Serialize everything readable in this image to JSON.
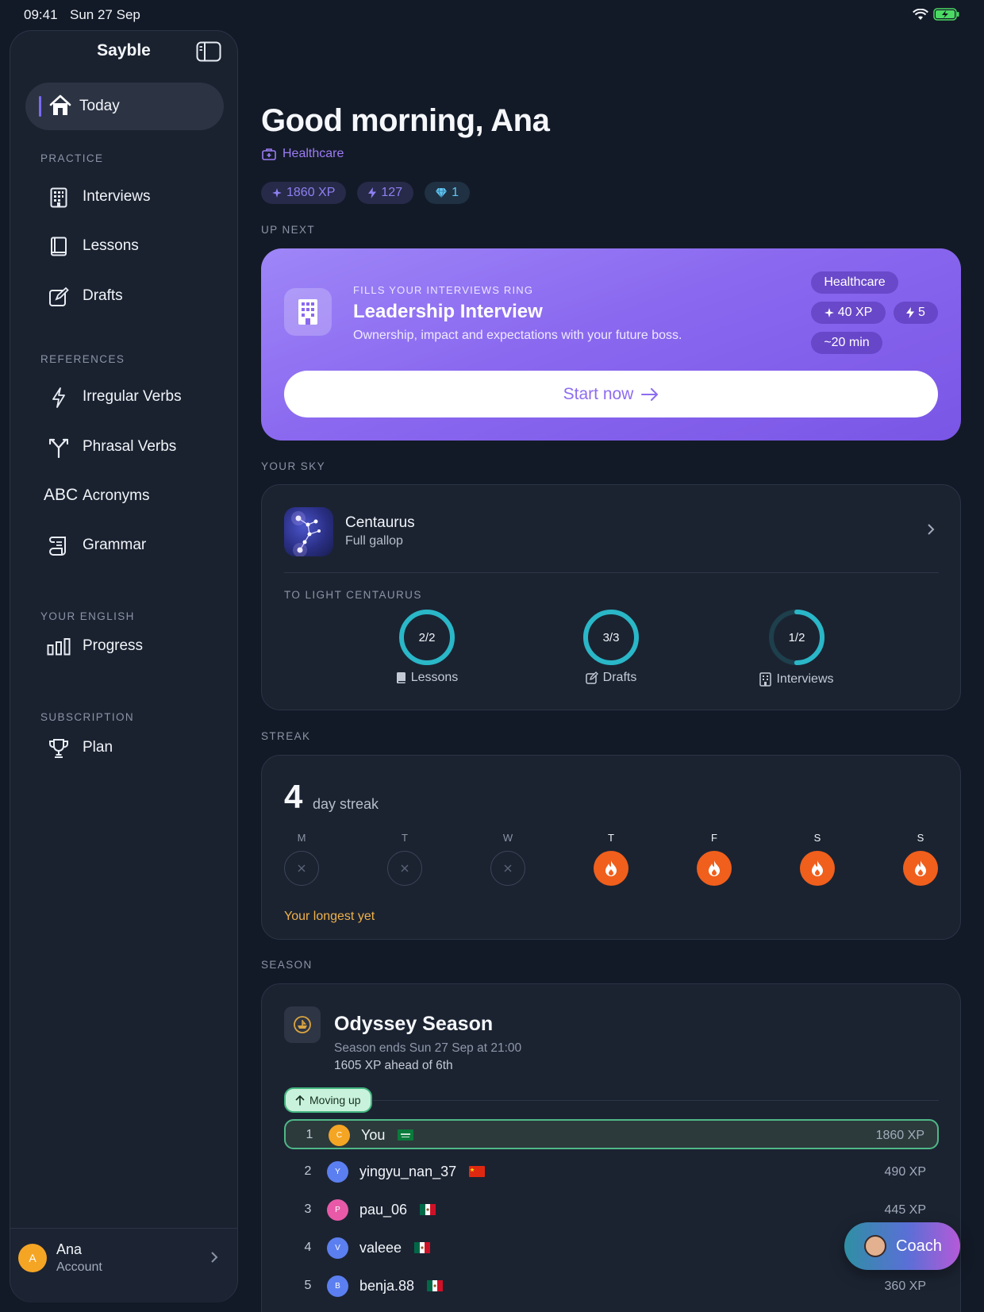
{
  "status_bar": {
    "time": "09:41",
    "date": "Sun 27 Sep"
  },
  "sidebar": {
    "app_title": "Sayble",
    "today": "Today",
    "sections": {
      "practice": "PRACTICE",
      "references": "REFERENCES",
      "your_english": "YOUR ENGLISH",
      "subscription": "SUBSCRIPTION"
    },
    "items": {
      "interviews": "Interviews",
      "lessons": "Lessons",
      "drafts": "Drafts",
      "irregular_verbs": "Irregular Verbs",
      "phrasal_verbs": "Phrasal Verbs",
      "acronyms_glyph": "ABC",
      "acronyms": "Acronyms",
      "grammar": "Grammar",
      "progress": "Progress",
      "plan": "Plan"
    },
    "account": {
      "avatar_letter": "A",
      "name": "Ana",
      "sub": "Account"
    }
  },
  "header": {
    "greeting": "Good morning, Ana",
    "track": "Healthcare",
    "stats": {
      "xp": "1860 XP",
      "streak": "127",
      "gems": "1"
    }
  },
  "up_next": {
    "label": "UP NEXT",
    "kicker": "FILLS YOUR INTERVIEWS RING",
    "title": "Leadership Interview",
    "description": "Ownership, impact and expectations with your future boss.",
    "tag": "Healthcare",
    "xp": "40 XP",
    "energy": "5",
    "duration": "~20 min",
    "cta": "Start now"
  },
  "sky": {
    "label": "YOUR SKY",
    "constellation": "Centaurus",
    "subtitle": "Full gallop",
    "rings_label": "TO LIGHT CENTAURUS",
    "rings": [
      {
        "value": "2/2",
        "label": "Lessons",
        "progress": 1.0
      },
      {
        "value": "3/3",
        "label": "Drafts",
        "progress": 1.0
      },
      {
        "value": "1/2",
        "label": "Interviews",
        "progress": 0.5
      }
    ]
  },
  "streak": {
    "label": "STREAK",
    "count": "4",
    "text": "day streak",
    "days": [
      {
        "letter": "M",
        "done": false
      },
      {
        "letter": "T",
        "done": false
      },
      {
        "letter": "W",
        "done": false
      },
      {
        "letter": "T",
        "done": true
      },
      {
        "letter": "F",
        "done": true
      },
      {
        "letter": "S",
        "done": true
      },
      {
        "letter": "S",
        "done": true
      }
    ],
    "note": "Your longest yet"
  },
  "season": {
    "label": "SEASON",
    "title": "Odyssey Season",
    "ends": "Season ends Sun 27 Sep at 21:00",
    "ahead": "1605 XP ahead of 6th",
    "moving_up": "Moving up",
    "leaderboard": [
      {
        "rank": "1",
        "initial": "C",
        "name": "You",
        "xp": "1860 XP",
        "color": "#f5a524",
        "flag": "sa"
      },
      {
        "rank": "2",
        "initial": "Y",
        "name": "yingyu_nan_37",
        "xp": "490 XP",
        "color": "#5b7ff0",
        "flag": "cn"
      },
      {
        "rank": "3",
        "initial": "P",
        "name": "pau_06",
        "xp": "445 XP",
        "color": "#e85aa8",
        "flag": "mx"
      },
      {
        "rank": "4",
        "initial": "V",
        "name": "valeee",
        "xp": "",
        "color": "#5b7ff0",
        "flag": "mx"
      },
      {
        "rank": "5",
        "initial": "B",
        "name": "benja.88",
        "xp": "360 XP",
        "color": "#5b7ff0",
        "flag": "mx"
      }
    ]
  },
  "coach": {
    "label": "Coach"
  },
  "colors": {
    "accent": "#8a68ef",
    "fire": "#f05f1c",
    "ring": "#2ab7c8",
    "bg": "#131a27"
  }
}
